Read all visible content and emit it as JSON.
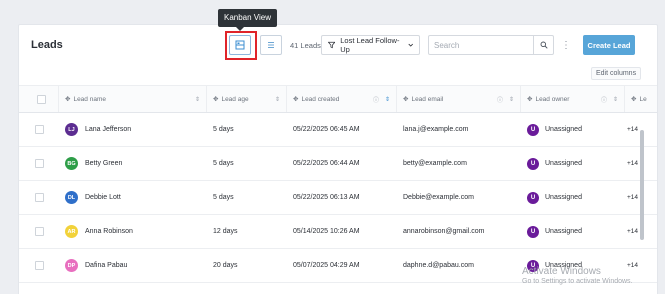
{
  "header": {
    "title": "Leads",
    "tooltip": "Kanban View",
    "lead_count": "41 Leads",
    "filter_label": "Lost Lead Follow-Up",
    "search_placeholder": "Search",
    "create_button": "Create Lead",
    "edit_columns": "Edit columns"
  },
  "table": {
    "columns": [
      "Lead name",
      "Lead age",
      "Lead created",
      "Lead email",
      "Lead owner",
      "Le"
    ],
    "rows": [
      {
        "initials": "LJ",
        "avatar_color": "#5c2d91",
        "name": "Lana Jefferson",
        "age": "5 days",
        "created": "05/22/2025 06:45 AM",
        "email": "lana.j@example.com",
        "owner_initial": "U",
        "owner": "Unassigned",
        "extra": "+14"
      },
      {
        "initials": "BG",
        "avatar_color": "#2e9e48",
        "name": "Betty Green",
        "age": "5 days",
        "created": "05/22/2025 06:44 AM",
        "email": "betty@example.com",
        "owner_initial": "U",
        "owner": "Unassigned",
        "extra": "+14"
      },
      {
        "initials": "DL",
        "avatar_color": "#2f6fc9",
        "name": "Debbie Lott",
        "age": "5 days",
        "created": "05/22/2025 06:13 AM",
        "email": "Debbie@example.com",
        "owner_initial": "U",
        "owner": "Unassigned",
        "extra": "+14"
      },
      {
        "initials": "AR",
        "avatar_color": "#f2d23a",
        "name": "Anna Robinson",
        "age": "12 days",
        "created": "05/14/2025 10:26 AM",
        "email": "annarobinson@gmail.com",
        "owner_initial": "U",
        "owner": "Unassigned",
        "extra": "+14"
      },
      {
        "initials": "DP",
        "avatar_color": "#e86fbf",
        "name": "Dafina Pabau",
        "age": "20 days",
        "created": "05/07/2025 04:29 AM",
        "email": "daphne.d@pabau.com",
        "owner_initial": "U",
        "owner": "Unassigned",
        "extra": "+14"
      }
    ]
  },
  "watermark": {
    "title": "Activate Windows",
    "subtitle": "Go to Settings to activate Windows."
  },
  "colors": {
    "accent": "#57a5d8",
    "highlight": "#e0242a",
    "owner_avatar": "#6a1b9a"
  }
}
